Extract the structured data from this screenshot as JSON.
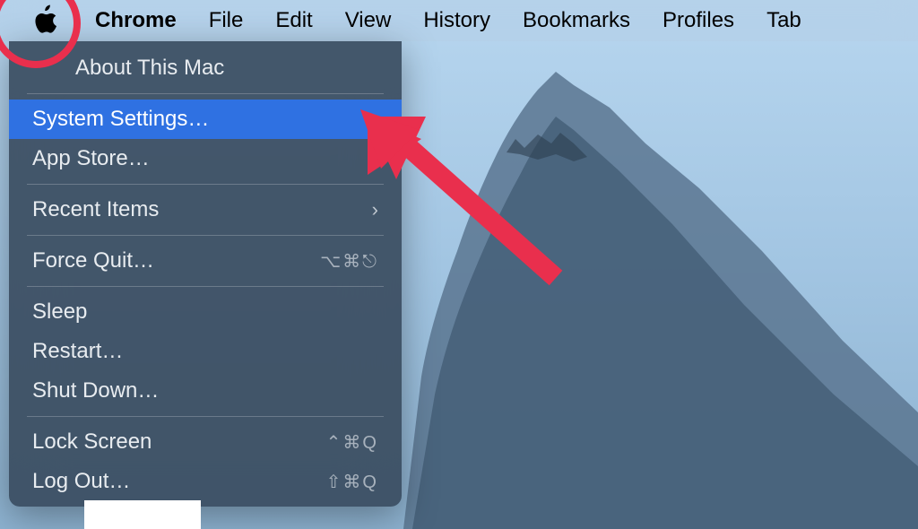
{
  "menubar": {
    "app": "Chrome",
    "items": [
      "File",
      "Edit",
      "View",
      "History",
      "Bookmarks",
      "Profiles",
      "Tab"
    ]
  },
  "apple_menu": {
    "about": "About This Mac",
    "system_settings": "System Settings…",
    "app_store": "App Store…",
    "recent_items": "Recent Items",
    "force_quit": "Force Quit…",
    "force_quit_shortcut": "⌥⌘⎋",
    "sleep": "Sleep",
    "restart": "Restart…",
    "shut_down": "Shut Down…",
    "lock_screen": "Lock Screen",
    "lock_screen_shortcut": "⌃⌘Q",
    "log_out": "Log Out…",
    "log_out_shortcut": "⇧⌘Q"
  },
  "annotations": {
    "arrow_color": "#e92f4d",
    "circle_color": "#e92f4d"
  }
}
